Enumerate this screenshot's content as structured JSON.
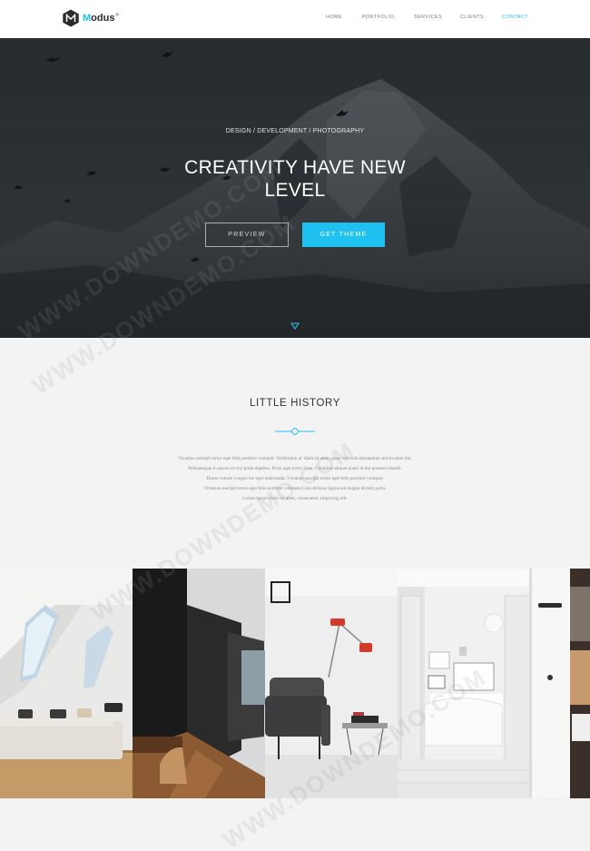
{
  "brand": {
    "name_first": "M",
    "name_rest": "odus",
    "sup": "®",
    "accent": "#1ec1f0"
  },
  "nav": {
    "items": [
      {
        "label": "HOME"
      },
      {
        "label": "PORTFOLIO"
      },
      {
        "label": "SERVICES"
      },
      {
        "label": "CLIENTS"
      },
      {
        "label": "CONTACT"
      }
    ],
    "active_index": 4
  },
  "hero": {
    "subtitle": "DESIGN / DEVELOPMENT / PHOTOGRAPHY",
    "title_line1": "CREATIVITY HAVE NEW",
    "title_line2": "LEVEL",
    "preview_label": "PREVIEW",
    "get_theme_label": "GET THEME",
    "scroll_icon": "chevron-down-icon"
  },
  "history": {
    "title": "LITTLE HISTORY",
    "lines": [
      "Vivamus suscipit tortor eget felis porttitor volutpat. Vestibulum ac diam sit amet quam vehicula elementum sed sit amet dui.",
      "Pellentesque in ipsum id orci porta dapibus. Proin eget tortor risus. Curabitur aliquet quam id dui posuere blandit.",
      "Donec rutrum congue leo eget malesuada. Vivamus suscipit tortor eget felis porttitor volutpat.",
      "Vivamus suscipit tortor eget felis porttitor volutpat. Cras ultricies ligula sed magna dictum porta.",
      "Lorem ipsum dolor sit amet, consectetur adipiscing elit."
    ]
  },
  "watermark": "WWW.DOWNDEMO.COM"
}
